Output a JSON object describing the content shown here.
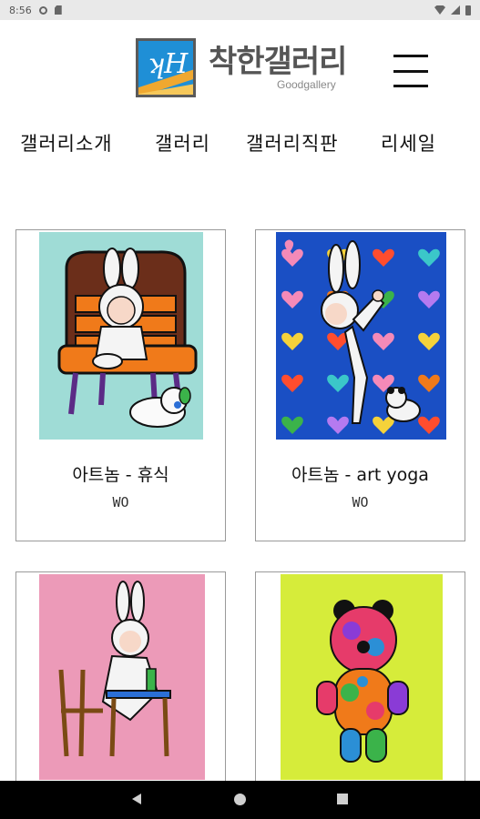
{
  "status_bar": {
    "time": "8:56",
    "icons": [
      "gear-icon",
      "sdcard-icon",
      "wifi-icon",
      "signal-icon",
      "battery-icon"
    ]
  },
  "header": {
    "logo_name": "착한갤러리",
    "logo_sub": "Goodgallery",
    "menu_icon": "hamburger-menu-icon"
  },
  "nav": {
    "items": [
      {
        "label": "갤러리소개"
      },
      {
        "label": "갤러리"
      },
      {
        "label": "갤러리직판"
      },
      {
        "label": "리세일"
      }
    ]
  },
  "gallery": {
    "cards": [
      {
        "title": "아트놈 - 휴식",
        "artist": "WO"
      },
      {
        "title": "아트놈 - art yoga",
        "artist": "WO"
      },
      {
        "title": "",
        "artist": ""
      },
      {
        "title": "",
        "artist": ""
      }
    ]
  },
  "colors": {
    "art1_bg": "#9fdcd6",
    "art2_bg": "#1a4fc4",
    "art3_bg": "#ec9ab8",
    "art4_bg": "#d6ec3a",
    "nav_bar": "#000000"
  }
}
